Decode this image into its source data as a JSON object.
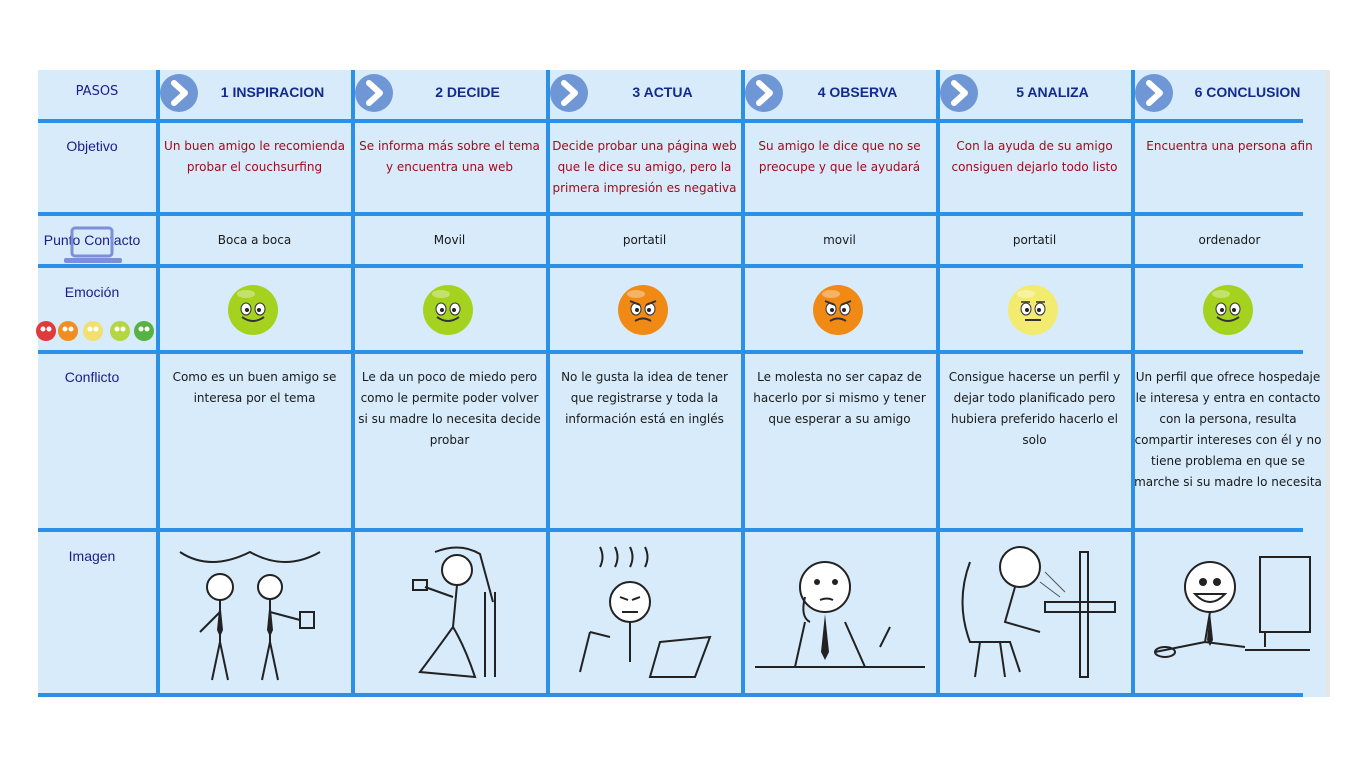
{
  "row_labels": {
    "pasos": "PASOS",
    "objetivo": "Objetivo",
    "punto_contacto": "Punto Contacto",
    "emocion": "Emoción",
    "conflicto": "Conflicto",
    "imagen": "Imagen"
  },
  "steps": [
    {
      "title": "1 INSPIRACION",
      "objetivo": "Un buen amigo le recomienda probar el couchsurfing",
      "contacto": "Boca a boca",
      "emocion": "happy",
      "conflicto": "Como es un buen amigo se interesa por el tema",
      "imagen": "two-friends-talking"
    },
    {
      "title": "2 DECIDE",
      "objetivo": "Se informa más sobre el tema y encuentra una web",
      "contacto": "Movil",
      "emocion": "happy",
      "conflicto": "Le da un poco de miedo pero como le permite poder volver si su madre lo necesita decide probar",
      "imagen": "woman-with-phone"
    },
    {
      "title": "3 ACTUA",
      "objetivo": "Decide probar una página web que le dice su amigo, pero la primera impresión es negativa",
      "contacto": "portatil",
      "emocion": "angry",
      "conflicto": "No le gusta la idea de tener que registrarse y toda la información está en inglés",
      "imagen": "frustrated-at-laptop"
    },
    {
      "title": "4 OBSERVA",
      "objetivo": "Su amigo le dice que no se preocupe y que le ayudará",
      "contacto": "movil",
      "emocion": "angry",
      "conflicto": "Le molesta no ser capaz de hacerlo por si mismo y tener que esperar a su amigo",
      "imagen": "thinking-man"
    },
    {
      "title": "5 ANALIZA",
      "objetivo": "Con la ayuda de su amigo consiguen dejarlo todo listo",
      "contacto": "portatil",
      "emocion": "neutral",
      "conflicto": "Consigue hacerse un perfil y dejar todo planificado pero hubiera preferido hacerlo el solo",
      "imagen": "man-at-computer-struggling"
    },
    {
      "title": "6 CONCLUSION",
      "objetivo": "Encuentra una persona afin",
      "contacto": "ordenador",
      "emocion": "happy",
      "conflicto": "Un perfil que ofrece hospedaje le interesa y entra en contacto con la persona, resulta compartir intereses con él y no tiene problema en que se marche si su madre lo necesita",
      "imagen": "smiling-man-at-computer"
    }
  ],
  "emotion_scale": [
    "red",
    "orange",
    "yellow",
    "light-green",
    "green"
  ],
  "colors": {
    "background": "#d7ebfb",
    "grid": "#2b90e6",
    "label": "#1c1c8a",
    "objetivo_text": "#a00c1a",
    "happy": "#a5d21e",
    "angry": "#f08a14",
    "neutral": "#f3ea70"
  }
}
